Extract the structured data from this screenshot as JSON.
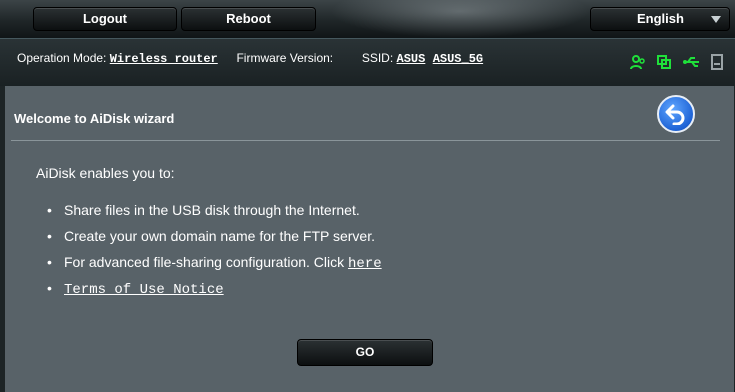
{
  "topbar": {
    "logout_label": "Logout",
    "reboot_label": "Reboot",
    "language": "English"
  },
  "status": {
    "op_mode_label": "Operation Mode:",
    "op_mode_value": "Wireless router",
    "firmware_label": "Firmware Version:",
    "ssid_label": "SSID:",
    "ssid_1": "ASUS",
    "ssid_2": "ASUS_5G",
    "icons": [
      "clients-icon",
      "network-map-icon",
      "usb-icon",
      "printer-icon"
    ],
    "icon_color": "#1fe03a"
  },
  "wizard": {
    "title": "Welcome to AiDisk wizard",
    "intro": "AiDisk enables you to:",
    "items": [
      "Share files in the USB disk through the Internet.",
      "Create your own domain name for the FTP server.",
      "For advanced file-sharing configuration. Click"
    ],
    "here_link": "here",
    "terms_link": "Terms of Use Notice",
    "go_label": "GO"
  }
}
